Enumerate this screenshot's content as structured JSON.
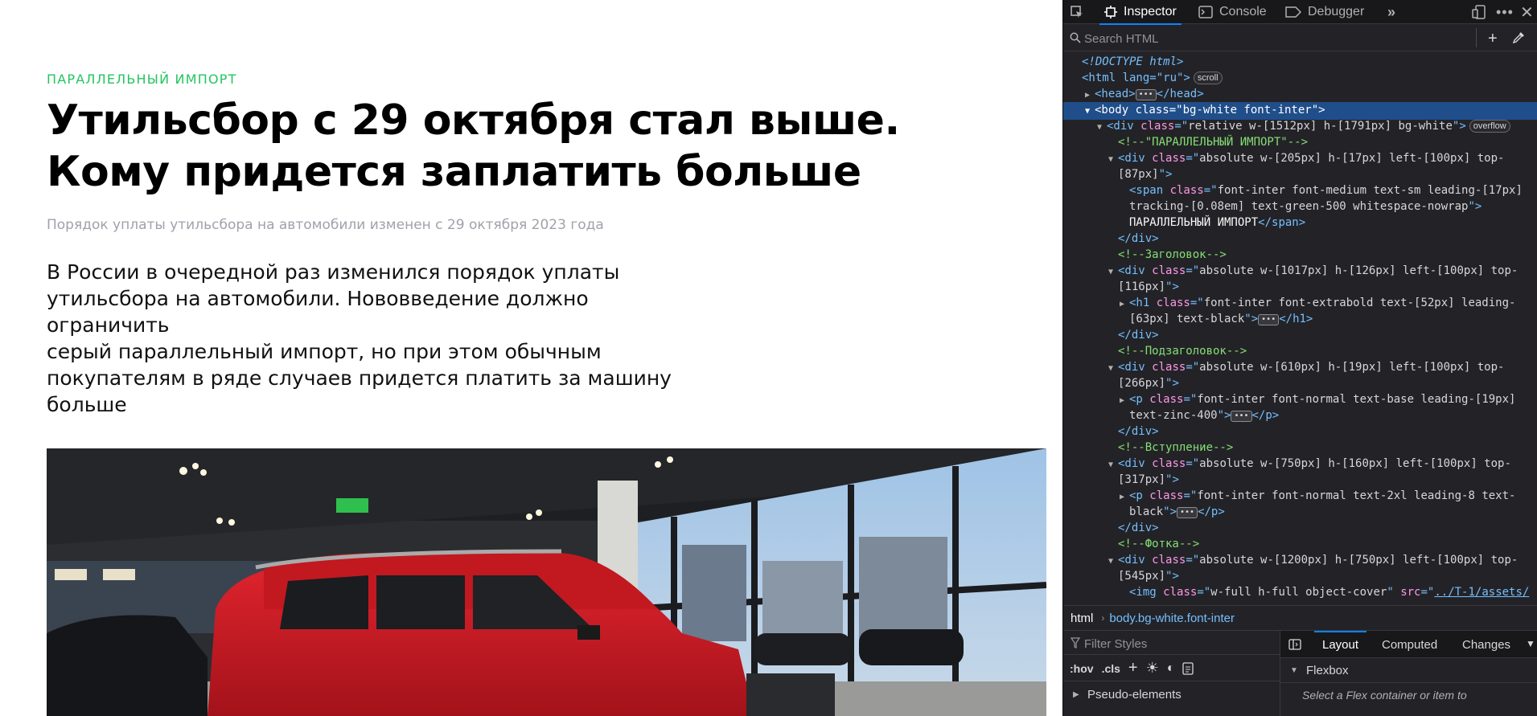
{
  "article": {
    "kicker": "ПАРАЛЛЕЛЬНЫЙ ИМПОРТ",
    "headline_line1": "Утильсбор с 29 октября стал выше.",
    "headline_line2": "Кому придется заплатить больше",
    "subtitle": "Порядок уплаты утильсбора на автомобили изменен с 29 октября 2023 года",
    "intro_lines": [
      "В России в очередной раз изменился порядок уплаты",
      "утильсбора на автомобили. Нововведение должно ограничить",
      "серый параллельный импорт, но при этом обычным",
      "покупателям в ряде случаев придется платить за машину",
      "больше"
    ]
  },
  "devtools": {
    "tabs": {
      "inspector": "Inspector",
      "console": "Console",
      "debugger": "Debugger"
    },
    "search_placeholder": "Search HTML",
    "tree": {
      "doctype": "<!DOCTYPE html>",
      "html_tag": "<html lang=\"ru\">",
      "scroll_badge": "scroll",
      "head_open": "<head>",
      "head_close": "</head>",
      "body_line": "<body class=\"bg-white font-inter\">",
      "div_wrapper_class": "relative w-[1512px] h-[1791px] bg-white",
      "overflow_badge": "overflow",
      "comment_kicker": "<!--\"ПАРАЛЛЕЛЬНЫЙ ИМПОРТ\"-->",
      "div1_class_a": "absolute w-[205px] h-[17px] left-[100px] top-",
      "div1_class_b": "[87px]",
      "span_class_a": "font-inter font-medium text-sm leading-[17px]",
      "span_class_b": "tracking-[0.08em] text-green-500 whitespace-nowrap",
      "span_text": "ПАРАЛЛЕЛЬНЫЙ ИМПОРТ",
      "div_close": "</div>",
      "comment_title": "<!--Заголовок-->",
      "div2_class_a": "absolute w-[1017px] h-[126px] left-[100px] top-",
      "div2_class_b": "[116px]",
      "h1_class_a": "font-inter font-extrabold text-[52px] leading-",
      "h1_class_b": "[63px] text-black",
      "comment_subtitle": "<!--Подзаголовок-->",
      "div3_class_a": "absolute w-[610px] h-[19px] left-[100px] top-",
      "div3_class_b": "[266px]",
      "p1_class_a": "font-inter font-normal text-base leading-[19px]",
      "p1_class_b": "text-zinc-400",
      "comment_intro": "<!--Вступление-->",
      "div4_class_a": "absolute w-[750px] h-[160px] left-[100px] top-",
      "div4_class_b": "[317px]",
      "p2_class_a": "font-inter font-normal text-2xl leading-8 text-",
      "p2_class_b": "black",
      "comment_photo": "<!--Фотка-->",
      "div5_class_a": "absolute w-[1200px] h-[750px] left-[100px] top-",
      "div5_class_b": "[545px]",
      "img_class": "w-full h-full object-cover",
      "img_src": "../T-1/assets/"
    },
    "breadcrumbs": [
      "html",
      "body.bg-white.font-inter"
    ],
    "filter_placeholder": "Filter Styles",
    "rules_tools": {
      "hov": ":hov",
      "cls": ".cls"
    },
    "pseudo_elements": "Pseudo-elements",
    "side_tabs": {
      "layout": "Layout",
      "computed": "Computed",
      "changes": "Changes"
    },
    "flexbox_heading": "Flexbox",
    "flexbox_message": "Select a Flex container or item to"
  },
  "colors": {
    "accent_green": "#22c55e",
    "devtools_bg": "#232327",
    "selection": "#204e8a",
    "tab_accent": "#0a84ff"
  },
  "icons": [
    "element-picker-icon",
    "inspector-icon",
    "console-icon",
    "debugger-icon",
    "more-tools-icon",
    "responsive-icon",
    "meatball-icon",
    "close-icon",
    "search-icon",
    "add-node-icon",
    "eyedropper-icon",
    "filter-icon",
    "plus-icon",
    "light-theme-icon",
    "dark-theme-icon",
    "print-icon",
    "sidebar-toggle-icon",
    "chevron-down-icon"
  ]
}
